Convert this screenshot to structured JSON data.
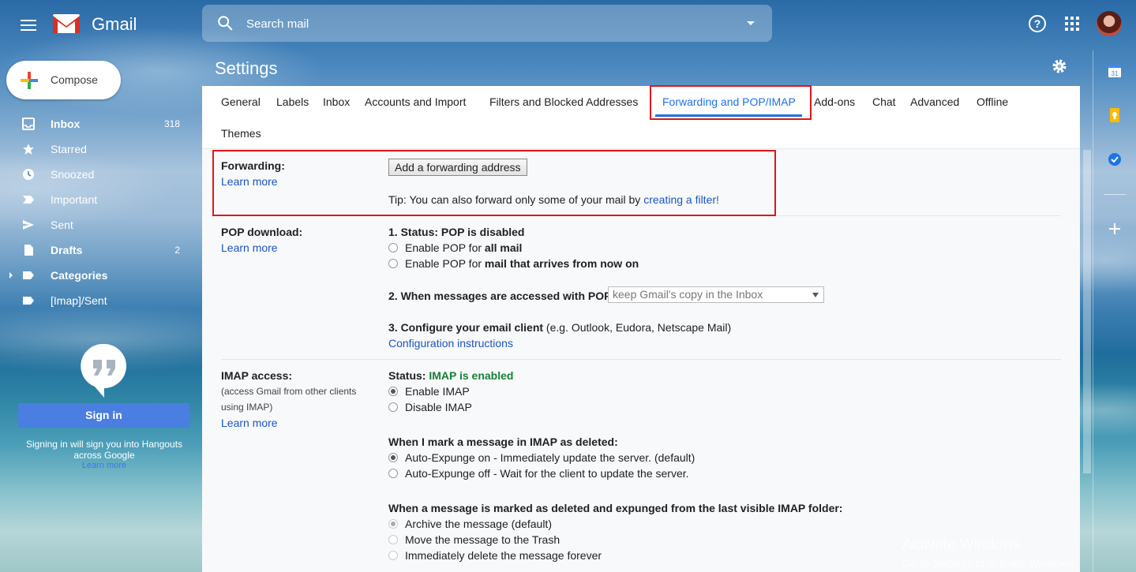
{
  "app": {
    "name": "Gmail"
  },
  "search": {
    "placeholder": "Search mail"
  },
  "compose": {
    "label": "Compose"
  },
  "sidebar": {
    "items": [
      {
        "label": "Inbox",
        "count": "318",
        "icon": "inbox-icon",
        "bold": true
      },
      {
        "label": "Starred",
        "count": "",
        "icon": "star-icon"
      },
      {
        "label": "Snoozed",
        "count": "",
        "icon": "clock-icon"
      },
      {
        "label": "Important",
        "count": "",
        "icon": "important-icon"
      },
      {
        "label": "Sent",
        "count": "",
        "icon": "send-icon"
      },
      {
        "label": "Drafts",
        "count": "2",
        "icon": "draft-icon",
        "bold": true
      },
      {
        "label": "Categories",
        "count": "",
        "icon": "label-icon",
        "bold": true
      },
      {
        "label": "[Imap]/Sent",
        "count": "",
        "icon": "label-icon"
      }
    ]
  },
  "hangouts": {
    "signin_label": "Sign in",
    "note": "Signing in will sign you into Hangouts across Google",
    "learn_more": "Learn more"
  },
  "settings": {
    "title": "Settings",
    "tabs": [
      "General",
      "Labels",
      "Inbox",
      "Accounts and Import",
      "Filters and Blocked Addresses",
      "Forwarding and POP/IMAP",
      "Add-ons",
      "Chat",
      "Advanced",
      "Offline",
      "Themes"
    ],
    "active_tab": "Forwarding and POP/IMAP",
    "forwarding": {
      "label": "Forwarding:",
      "learn_more": "Learn more",
      "button": "Add a forwarding address",
      "tip_prefix": "Tip: You can also forward only some of your mail by ",
      "tip_link": "creating a filter!"
    },
    "pop": {
      "label": "POP download:",
      "learn_more": "Learn more",
      "status_prefix": "1. Status: ",
      "status": "POP is disabled",
      "opt1_prefix": "Enable POP for ",
      "opt1_bold": "all mail",
      "opt2_prefix": "Enable POP for ",
      "opt2_bold": "mail that arrives from now on",
      "when_label": "2. When messages are accessed with POP",
      "when_value": "keep Gmail's copy in the Inbox",
      "configure_label": "3. Configure your email client",
      "configure_note": " (e.g. Outlook, Eudora, Netscape Mail)",
      "config_link": "Configuration instructions"
    },
    "imap": {
      "label": "IMAP access:",
      "note_line1": "(access Gmail from other clients",
      "note_line2": "using IMAP)",
      "learn_more": "Learn more",
      "status_prefix": "Status: ",
      "status": "IMAP is enabled",
      "enable": "Enable IMAP",
      "disable": "Disable IMAP",
      "deleted_heading": "When I mark a message in IMAP as deleted:",
      "expunge_on": "Auto-Expunge on - Immediately update the server. (default)",
      "expunge_off": "Auto-Expunge off - Wait for the client to update the server.",
      "expunged_heading": "When a message is marked as deleted and expunged from the last visible IMAP folder:",
      "archive": "Archive the message (default)",
      "trash": "Move the message to the Trash",
      "delete_forever": "Immediately delete the message forever"
    }
  },
  "watermark": {
    "line1": "Activate Windows",
    "line2": "Go to Settings to activate Windows."
  },
  "colors": {
    "accent": "#1a73e8",
    "highlight_box": "#e0151b",
    "enabled_green": "#188038"
  }
}
